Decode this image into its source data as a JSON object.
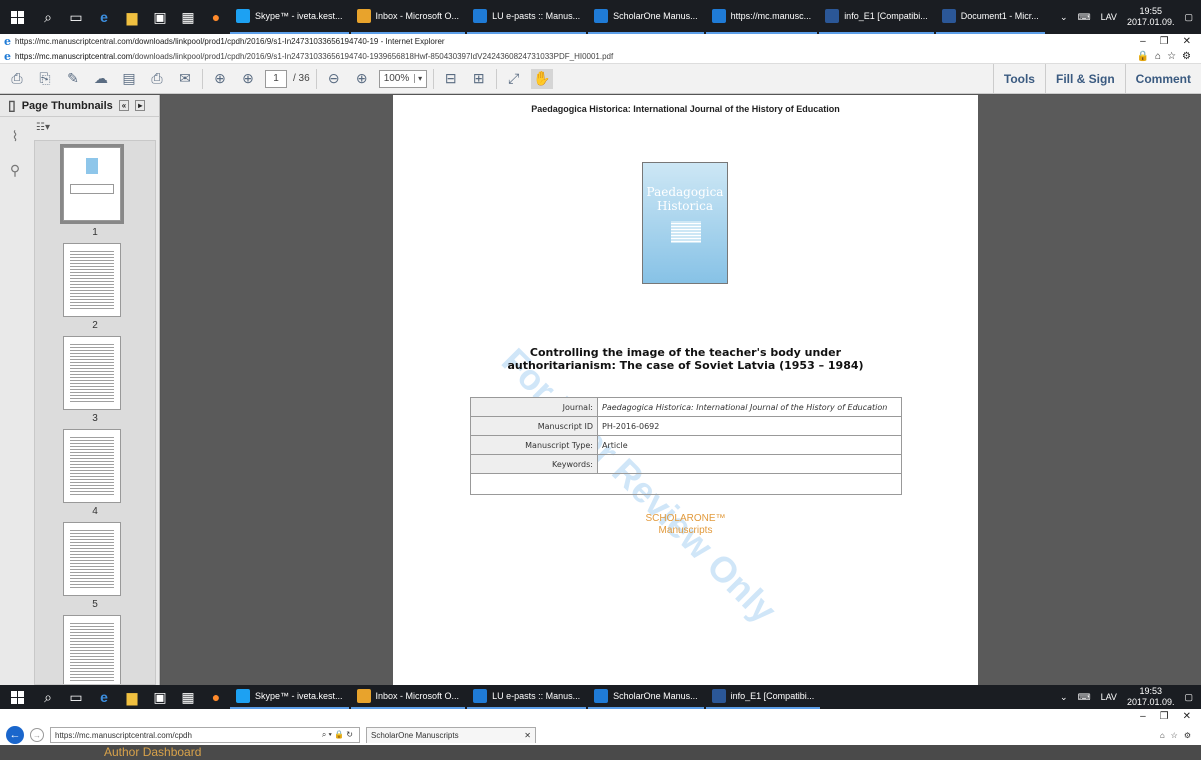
{
  "taskbar_top": {
    "apps": [
      {
        "label": "Skype™ - iveta.kest...",
        "color": "#1da1f2"
      },
      {
        "label": "Inbox - Microsoft O...",
        "color": "#e8a32c"
      },
      {
        "label": "LU e-pasts :: Manus...",
        "color": "#1f7bd6"
      },
      {
        "label": "ScholarOne Manus...",
        "color": "#1f7bd6"
      },
      {
        "label": "https://mc.manusc...",
        "color": "#1f7bd6"
      },
      {
        "label": "info_E1 [Compatibi...",
        "color": "#2b5797"
      },
      {
        "label": "Document1 - Micr...",
        "color": "#2b5797"
      }
    ],
    "lang": "LAV",
    "time": "19:55",
    "date": "2017.01.09."
  },
  "taskbar_bottom": {
    "apps": [
      {
        "label": "Skype™ - iveta.kest...",
        "color": "#1da1f2"
      },
      {
        "label": "Inbox - Microsoft O...",
        "color": "#e8a32c"
      },
      {
        "label": "LU e-pasts :: Manus...",
        "color": "#1f7bd6"
      },
      {
        "label": "ScholarOne Manus...",
        "color": "#1f7bd6"
      },
      {
        "label": "info_E1 [Compatibi...",
        "color": "#2b5797"
      }
    ],
    "lang": "LAV",
    "time": "19:53",
    "date": "2017.01.09."
  },
  "browser": {
    "title": "https://mc.manuscriptcentral.com/downloads/linkpool/prod1/cpdh/2016/9/s1-In24731033656194740-19 - Internet Explorer",
    "url_host": "https://mc.manuscriptcentral.com",
    "url_path": "/downloads/linkpool/prod1/cpdh/2016/9/s1-In24731033656194740-1939656818Hwf-850430397IdV2424360824731033PDF_HI0001.pdf"
  },
  "pdf_toolbar": {
    "page_current": "1",
    "page_total": "/ 36",
    "zoom": "100%",
    "tools_label": "Tools",
    "fill_sign_label": "Fill & Sign",
    "comment_label": "Comment"
  },
  "sidebar": {
    "title": "Page Thumbnails",
    "pages": [
      "1",
      "2",
      "3",
      "4",
      "5"
    ]
  },
  "document": {
    "journal_header": "Paedagogica Historica: International Journal of the History of Education",
    "cover_title_1": "Paedagogica",
    "cover_title_2": "Historica",
    "watermark": "For Peer Review Only",
    "title_line1": "Controlling the image of the teacher's body under",
    "title_line2": "authoritarianism: The case of Soviet Latvia (1953 – 1984)",
    "meta": {
      "journal_key": "Journal:",
      "journal_val": "Paedagogica Historica: International Journal of the History of Education",
      "id_key": "Manuscript ID",
      "id_val": "PH-2016-0692",
      "type_key": "Manuscript Type:",
      "type_val": "Article",
      "kw_key": "Keywords:",
      "kw_val": ""
    },
    "logo_line1": "SCHOLARONE™",
    "logo_line2": "Manuscripts"
  },
  "bottom_browser": {
    "url": "https://mc.manuscriptcentral.com/cpdh",
    "tab": "ScholarOne Manuscripts",
    "dashboard": "Author Dashboard"
  }
}
